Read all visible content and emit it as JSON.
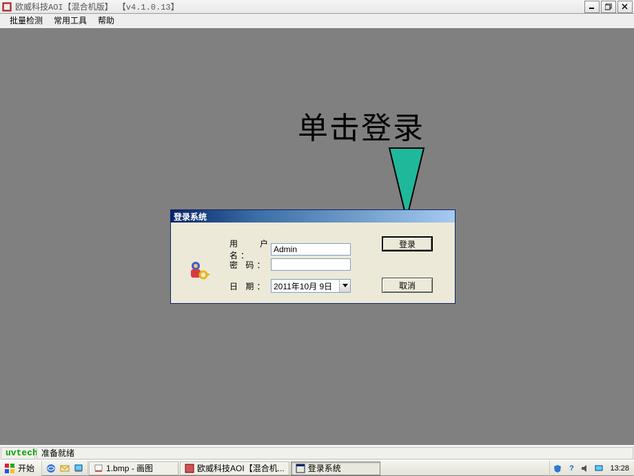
{
  "window": {
    "title": "欧威科技AOI【混合机版】 【v4.1.0.13】"
  },
  "menu": {
    "items": [
      "批量检测",
      "常用工具",
      "帮助"
    ]
  },
  "annotation": {
    "text": "单击登录"
  },
  "dialog": {
    "title": "登录系统",
    "labels": {
      "username": "用户名：",
      "password": "密  码：",
      "date": "日  期："
    },
    "values": {
      "username": "Admin",
      "password": "",
      "date": "2011年10月 9日"
    },
    "buttons": {
      "login": "登录",
      "cancel": "取消"
    }
  },
  "statusbar": {
    "brand": "uvtech",
    "status": "准备就绪"
  },
  "taskbar": {
    "start": "开始",
    "tasks": [
      {
        "label": "1.bmp - 画图"
      },
      {
        "label": "欧威科技AOI【混合机..."
      },
      {
        "label": "登录系统"
      }
    ],
    "clock": "13:28"
  },
  "icons": {
    "minimize": "minimize-icon",
    "maximize": "maximize-icon",
    "close": "close-icon",
    "dropdown": "chevron-down-icon"
  }
}
